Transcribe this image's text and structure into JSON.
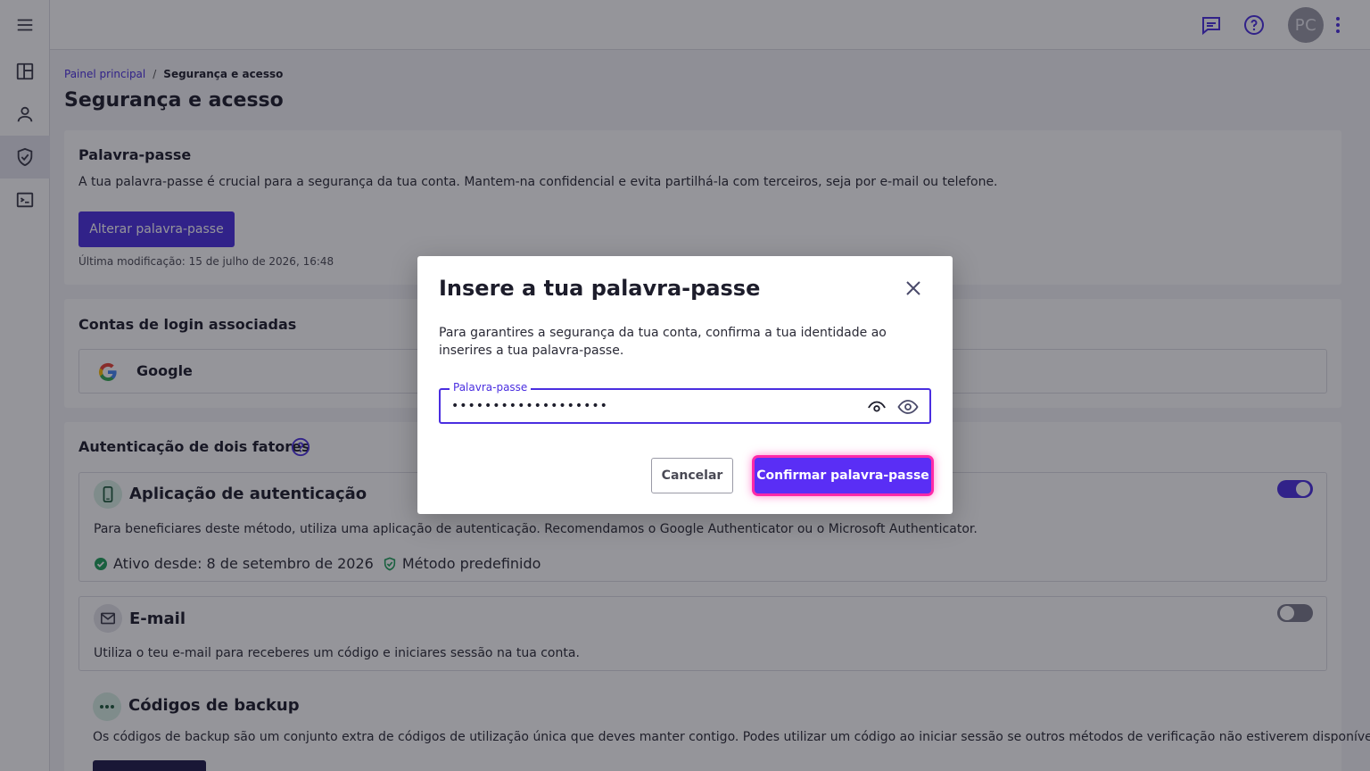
{
  "topbar": {
    "avatar_initials": "PC",
    "icons": [
      "feedback-icon",
      "help-icon",
      "more-vert-icon"
    ]
  },
  "sidebar": {
    "items": [
      {
        "name": "menu-icon"
      },
      {
        "name": "dashboard-icon"
      },
      {
        "name": "person-icon"
      },
      {
        "name": "shield-icon",
        "active": true
      },
      {
        "name": "terminal-icon"
      }
    ]
  },
  "breadcrumb": {
    "home": "Painel principal",
    "separator": "/",
    "current": "Segurança e acesso"
  },
  "page": {
    "title": "Segurança e acesso"
  },
  "password_card": {
    "title": "Palavra-passe",
    "description": "A tua palavra-passe é crucial para a segurança da tua conta. Mantem-na confidencial e evita partilhá-la com terceiros, seja por e-mail ou telefone.",
    "button": "Alterar palavra-passe",
    "last_modified": "Última modificação: 15 de julho de 2026, 16:48"
  },
  "login_card": {
    "title": "Contas de login associadas",
    "provider": "Google"
  },
  "twofa_card": {
    "title": "Autenticação de dois fatores",
    "app_method": {
      "title": "Aplicação de autenticação",
      "description": "Para beneficiares deste método, utiliza uma aplicação de autenticação. Recomendamos o Google Authenticator ou o Microsoft Authenticator.",
      "active_since": "Ativo desde: 8 de setembro de 2026",
      "default_label": "Método predefinido",
      "enabled": true
    },
    "email_method": {
      "title": "E-mail",
      "description": "Utiliza o teu e-mail para receberes um código e iniciares sessão na tua conta.",
      "enabled": false
    },
    "backup_codes": {
      "title": "Códigos de backup",
      "description": "Os códigos de backup são um conjunto extra de códigos de utilização única que deves manter contigo. Podes utilizar um código ao iniciar sessão se outros métodos de verificação não estiverem disponíveis."
    }
  },
  "dialog": {
    "title": "Insere a tua palavra-passe",
    "description": "Para garantires a segurança da tua conta, confirma a tua identidade ao inserires a tua palavra-passe.",
    "field_label": "Palavra-passe",
    "field_value": "•••••••••••••••••••",
    "cancel": "Cancelar",
    "confirm": "Confirmar palavra-passe"
  },
  "colors": {
    "accent": "#4a2ee0",
    "confirm_glow": "#ff2aa8",
    "success": "#1e9e5a"
  }
}
